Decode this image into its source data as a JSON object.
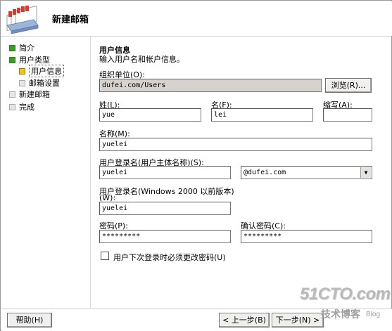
{
  "window": {
    "title": "新建邮箱"
  },
  "nav": {
    "items": [
      {
        "label": "简介",
        "state": "done"
      },
      {
        "label": "用户类型",
        "state": "done"
      },
      {
        "label": "用户信息",
        "state": "current"
      },
      {
        "label": "邮箱设置",
        "state": "pending"
      },
      {
        "label": "新建邮箱",
        "state": "pending"
      },
      {
        "label": "完成",
        "state": "pending"
      }
    ]
  },
  "form": {
    "section_title": "用户信息",
    "section_subtitle": "输入用户名和帐户信息。",
    "ou_label": "组织单位(O):",
    "ou_value": "dufei.com/Users",
    "browse_label": "浏览(R)...",
    "last_name_label": "姓(L):",
    "last_name_value": "yue",
    "first_name_label": "名(F):",
    "first_name_value": "lei",
    "initials_label": "缩写(A):",
    "initials_value": "",
    "name_label": "名称(M):",
    "name_value": "yuelei",
    "upn_label": "用户登录名(用户主体名称)(S):",
    "upn_value": "yuelei",
    "upn_domain_value": "@dufei.com",
    "pre2000_label_line1": "用户登录名(Windows 2000 以前版本)",
    "pre2000_label_line2": "(W):",
    "pre2000_value": "yuelei",
    "password_label": "密码(P):",
    "password_value": "*********",
    "confirm_label": "确认密码(C):",
    "confirm_value": "*********",
    "must_change_label": "用户下次登录时必须更改密码(U)",
    "must_change_checked": false
  },
  "footer": {
    "help_label": "帮助(H)",
    "back_label": "< 上一步(B)",
    "next_label": "下一步(N) >"
  },
  "watermark": {
    "brand": "51CTO.com",
    "sub": "技术博客",
    "blog": "Blog"
  },
  "colors": {
    "nav_done": "#3a9d23",
    "nav_current": "#f2c318",
    "nav_pending": "#e6e6e6",
    "readonly_bg": "#d6d3ce",
    "button_bg": "#f0efec"
  }
}
